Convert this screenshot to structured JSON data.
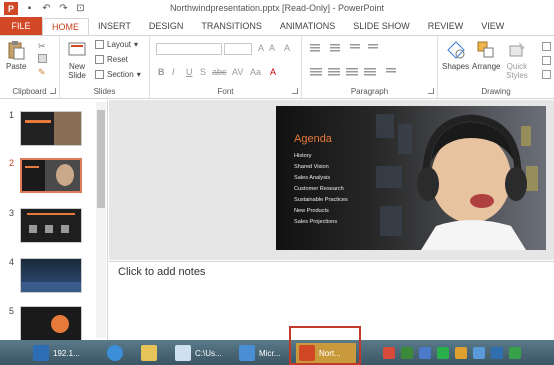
{
  "titlebar": {
    "title": "Northwindpresentation.pptx [Read-Only] - PowerPoint",
    "app_logo": "P"
  },
  "tabs": [
    "FILE",
    "HOME",
    "INSERT",
    "DESIGN",
    "TRANSITIONS",
    "ANIMATIONS",
    "SLIDE SHOW",
    "REVIEW",
    "VIEW"
  ],
  "ribbon": {
    "clipboard": {
      "paste": "Paste",
      "label": "Clipboard"
    },
    "slides": {
      "new_slide_1": "New",
      "new_slide_2": "Slide",
      "layout": "Layout",
      "reset": "Reset",
      "section": "Section",
      "label": "Slides"
    },
    "font": {
      "label": "Font",
      "buttons": [
        "B",
        "I",
        "U",
        "S",
        "abc",
        "AV",
        "Aa"
      ]
    },
    "paragraph": {
      "label": "Paragraph"
    },
    "drawing": {
      "shapes": "Shapes",
      "arrange": "Arrange",
      "quick_styles_1": "Quick",
      "quick_styles_2": "Styles",
      "label": "Drawing"
    }
  },
  "thumbnails": [
    {
      "number": "1",
      "selected": false
    },
    {
      "number": "2",
      "selected": true
    },
    {
      "number": "3",
      "selected": false
    },
    {
      "number": "4",
      "selected": false
    },
    {
      "number": "5",
      "selected": false
    }
  ],
  "slide": {
    "title": "Agenda",
    "items": [
      "History",
      "Shared Vision",
      "Sales Analysis",
      "Customer Research",
      "Sustainable Practices",
      "New Products",
      "Sales Projections"
    ]
  },
  "notes": {
    "placeholder": "Click to add notes"
  },
  "taskbar": {
    "items": [
      {
        "label": "192.1..."
      },
      {
        "label": "C:\\Us..."
      },
      {
        "label": "Micr..."
      },
      {
        "label": "Nort..."
      }
    ]
  },
  "colors": {
    "accent": "#d24726",
    "slide_title": "#e57a3a"
  }
}
